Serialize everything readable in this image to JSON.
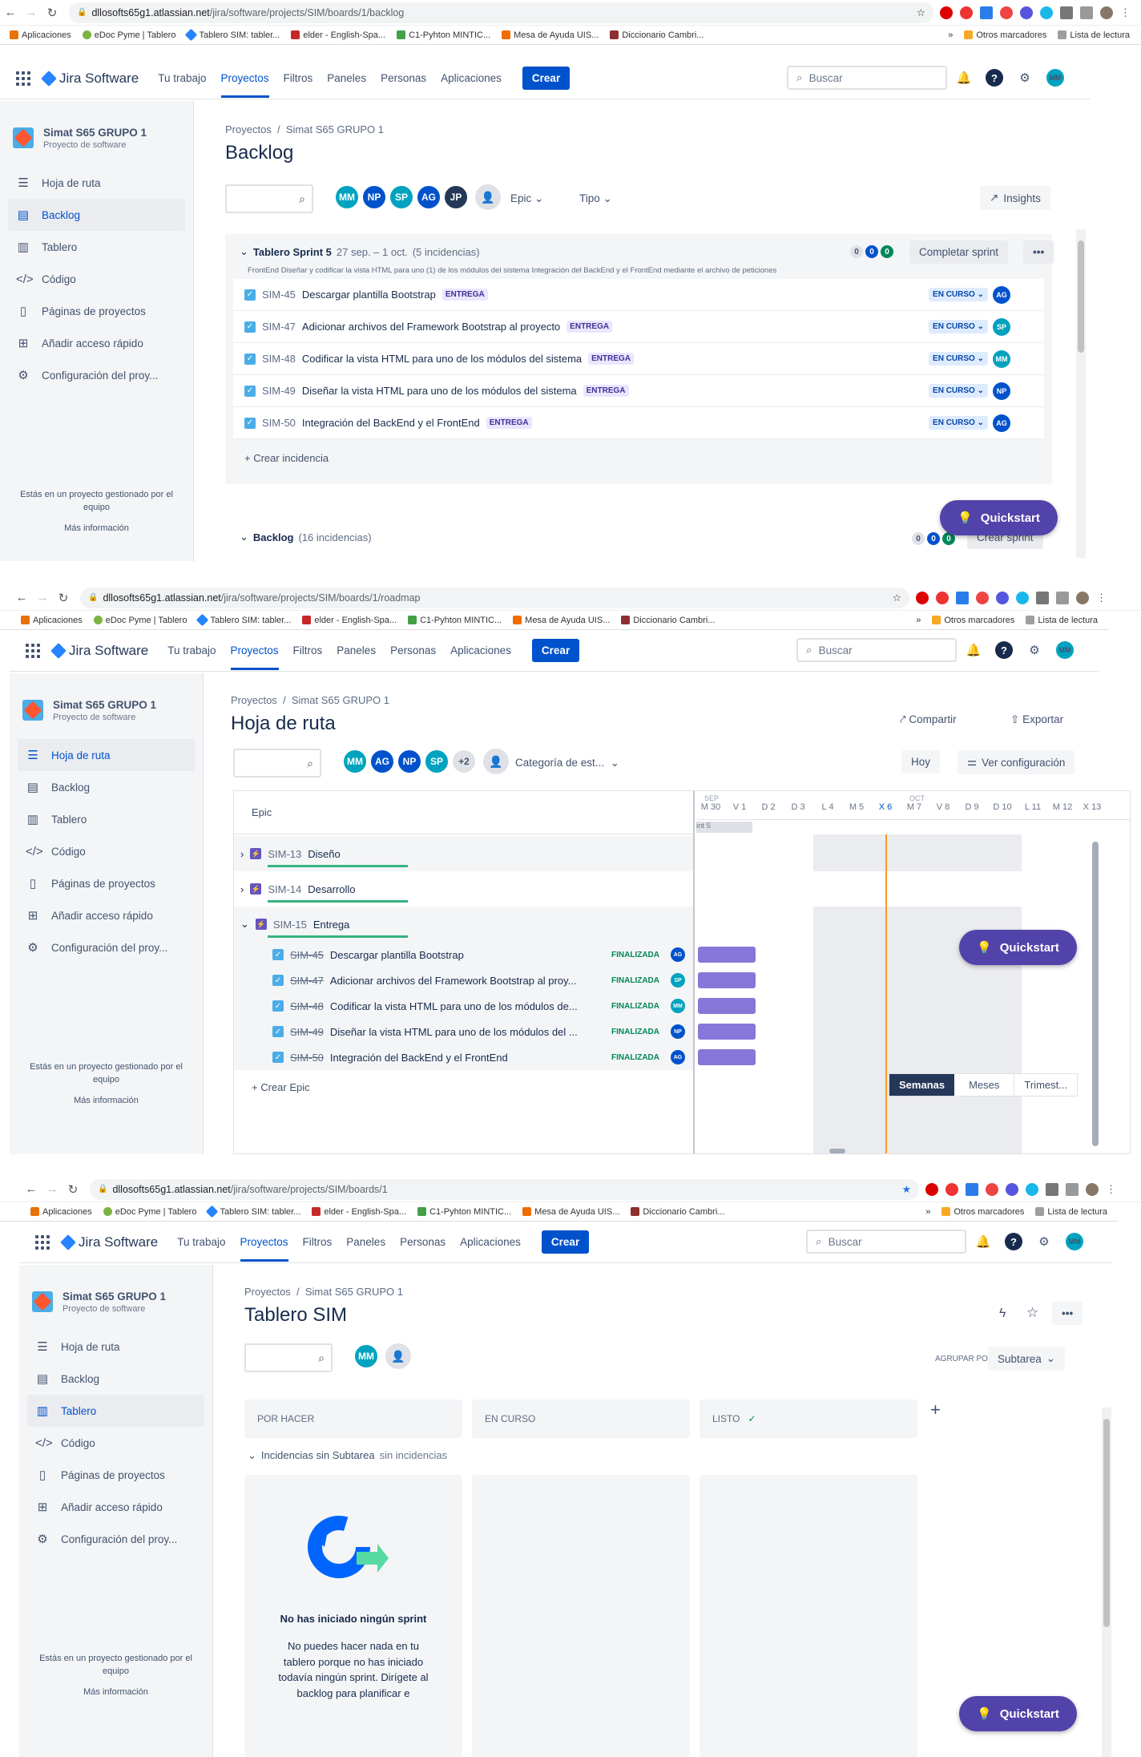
{
  "browser": {
    "shot1_url_host": "dllosofts65g1.atlassian.net",
    "shot1_url_path": "/jira/software/projects/SIM/boards/1/backlog",
    "shot2_url_host": "dllosofts65g1.atlassian.net",
    "shot2_url_path": "/jira/software/projects/SIM/boards/1/roadmap",
    "shot3_url_host": "dllosofts65g1.atlassian.net",
    "shot3_url_path": "/jira/software/projects/SIM/boards/1",
    "bookmarks": [
      "Aplicaciones",
      "eDoc Pyme | Tablero",
      "Tablero SIM: tabler...",
      "elder - English-Spa...",
      "C1-Pyhton MINTIC...",
      "Mesa de Ayuda UIS...",
      "Diccionario Cambri..."
    ],
    "bookmarks_more": "»",
    "other_bookmarks": "Otros marcadores",
    "reading_list": "Lista de lectura"
  },
  "topnav": {
    "logo": "Jira Software",
    "items": [
      "Tu trabajo",
      "Proyectos",
      "Filtros",
      "Paneles",
      "Personas",
      "Aplicaciones"
    ],
    "create": "Crear",
    "search_placeholder": "Buscar",
    "user_initials": "MM"
  },
  "sidebar": {
    "project_name": "Simat S65 GRUPO 1",
    "project_type": "Proyecto de software",
    "items": [
      "Hoja de ruta",
      "Backlog",
      "Tablero",
      "Código",
      "Páginas de proyectos",
      "Añadir acceso rápido",
      "Configuración del proy..."
    ],
    "footer_text": "Estás en un proyecto gestionado por el equipo",
    "footer_link": "Más información"
  },
  "backlog": {
    "crumb_projects": "Proyectos",
    "crumb_project": "Simat S65 GRUPO 1",
    "title": "Backlog",
    "assignees": [
      "MM",
      "NP",
      "SP",
      "AG",
      "JP"
    ],
    "filter_epic": "Epic",
    "filter_type": "Tipo",
    "insights": "Insights",
    "sprint_name": "Tablero Sprint 5",
    "sprint_dates": "27 sep. – 1 oct.",
    "sprint_count": "(5 incidencias)",
    "sprint_counts": [
      "0",
      "0",
      "0"
    ],
    "complete_sprint": "Completar sprint",
    "sprint_goal": "FrontEnd Diseñar y codificar la vista HTML para uno (1) de los módulos del sistema Integración del BackEnd y el FrontEnd mediante el archivo de peticiones",
    "issues": [
      {
        "key": "SIM-45",
        "summary": "Descargar plantilla Bootstrap",
        "epic": "ENTREGA",
        "status": "EN CURSO",
        "assignee": "AG"
      },
      {
        "key": "SIM-47",
        "summary": "Adicionar archivos del Framework Bootstrap al proyecto",
        "epic": "ENTREGA",
        "status": "EN CURSO",
        "assignee": "SP"
      },
      {
        "key": "SIM-48",
        "summary": "Codificar la vista HTML para uno de los módulos del sistema",
        "epic": "ENTREGA",
        "status": "EN CURSO",
        "assignee": "MM"
      },
      {
        "key": "SIM-49",
        "summary": "Diseñar la vista HTML para uno de los módulos del sistema",
        "epic": "ENTREGA",
        "status": "EN CURSO",
        "assignee": "NP"
      },
      {
        "key": "SIM-50",
        "summary": "Integración del BackEnd y el FrontEnd",
        "epic": "ENTREGA",
        "status": "EN CURSO",
        "assignee": "AG"
      }
    ],
    "create_issue": "+ Crear incidencia",
    "backlog_label": "Backlog",
    "backlog_count": "(16 incidencias)",
    "backlog_counts": [
      "0",
      "0",
      "0"
    ],
    "create_sprint": "Crear sprint",
    "quickstart": "Quickstart"
  },
  "roadmap": {
    "crumb_projects": "Proyectos",
    "crumb_project": "Simat S65 GRUPO 1",
    "title": "Hoja de ruta",
    "share": "Compartir",
    "export": "Exportar",
    "assignees": [
      "MM",
      "AG",
      "NP",
      "SP"
    ],
    "more_assignees": "+2",
    "status_category": "Categoría de est...",
    "today": "Hoy",
    "view_settings": "Ver configuración",
    "epic_header": "Epic",
    "month_sep": "SEP",
    "month_oct": "OCT",
    "days": [
      "M 30",
      "V 1",
      "D 2",
      "D 3",
      "L 4",
      "M 5",
      "X 6",
      "M 7",
      "V 8",
      "D 9",
      "D 10",
      "L 11",
      "M 12",
      "X 13"
    ],
    "sprint_label": "int 5",
    "epics": [
      {
        "key": "SIM-13",
        "name": "Diseño"
      },
      {
        "key": "SIM-14",
        "name": "Desarrollo"
      },
      {
        "key": "SIM-15",
        "name": "Entrega"
      }
    ],
    "children": [
      {
        "key": "SIM-45",
        "summary": "Descargar plantilla Bootstrap",
        "status": "FINALIZADA",
        "assignee": "AG"
      },
      {
        "key": "SIM-47",
        "summary": "Adicionar archivos del Framework Bootstrap al proy...",
        "status": "FINALIZADA",
        "assignee": "SP"
      },
      {
        "key": "SIM-48",
        "summary": "Codificar la vista HTML para uno de los módulos de...",
        "status": "FINALIZADA",
        "assignee": "MM"
      },
      {
        "key": "SIM-49",
        "summary": "Diseñar la vista HTML para uno de los módulos del ...",
        "status": "FINALIZADA",
        "assignee": "NP"
      },
      {
        "key": "SIM-50",
        "summary": "Integración del BackEnd y el FrontEnd",
        "status": "FINALIZADA",
        "assignee": "AG"
      }
    ],
    "create_epic": "+ Crear Epic",
    "scale": [
      "Semanas",
      "Meses",
      "Trimest..."
    ],
    "quickstart": "Quickstart"
  },
  "board": {
    "crumb_projects": "Proyectos",
    "crumb_project": "Simat S65 GRUPO 1",
    "title": "Tablero SIM",
    "assignees": [
      "MM"
    ],
    "group_by_label": "AGRUPAR POR",
    "group_by_value": "Subtarea",
    "columns": [
      "POR HACER",
      "EN CURSO",
      "LISTO"
    ],
    "swimlane": "Incidencias sin Subtarea",
    "swimlane_note": "sin incidencias",
    "empty_title": "No has iniciado ningún sprint",
    "empty_body": "No puedes hacer nada en tu tablero porque no has iniciado todavía ningún sprint. Dirígete al backlog para planificar e",
    "quickstart": "Quickstart"
  },
  "colors": {
    "brand": "#0052cc",
    "quickstart": "#5243aa",
    "epic_bar": "#8777d9",
    "done": "#00875a",
    "today_line": "#ff991f"
  }
}
